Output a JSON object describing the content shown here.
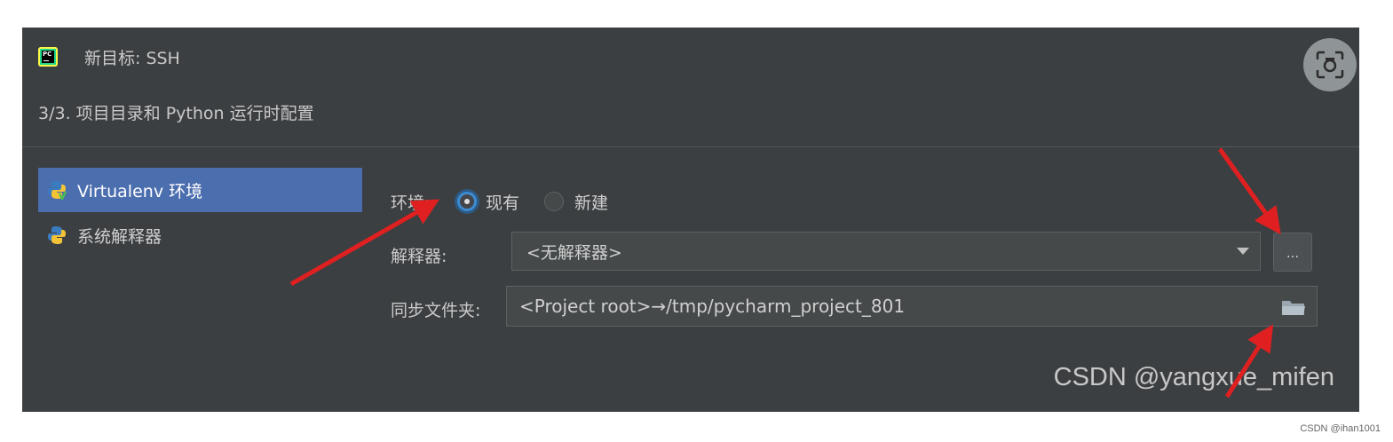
{
  "dialog": {
    "title": "新目标: SSH",
    "step": "3/3. 项目目录和 Python 运行时配置"
  },
  "sidebar": {
    "items": [
      {
        "label": "Virtualenv 环境",
        "selected": true
      },
      {
        "label": "系统解释器",
        "selected": false
      }
    ]
  },
  "form": {
    "env_label": "环境:",
    "env_options": [
      {
        "label": "现有",
        "checked": true
      },
      {
        "label": "新建",
        "checked": false
      }
    ],
    "interpreter_label": "解释器:",
    "interpreter_value": "<无解释器>",
    "more_button_label": "...",
    "sync_label": "同步文件夹:",
    "sync_value": "<Project root>→/tmp/pycharm_project_801"
  },
  "watermark": "CSDN @yangxue_mifen",
  "corner_mark": "CSDN @ihan1001",
  "colors": {
    "background": "#3c3f41",
    "selection": "#4b6eaf",
    "radio_focus": "#3d8bcf",
    "annotation_arrow": "#e02020"
  }
}
